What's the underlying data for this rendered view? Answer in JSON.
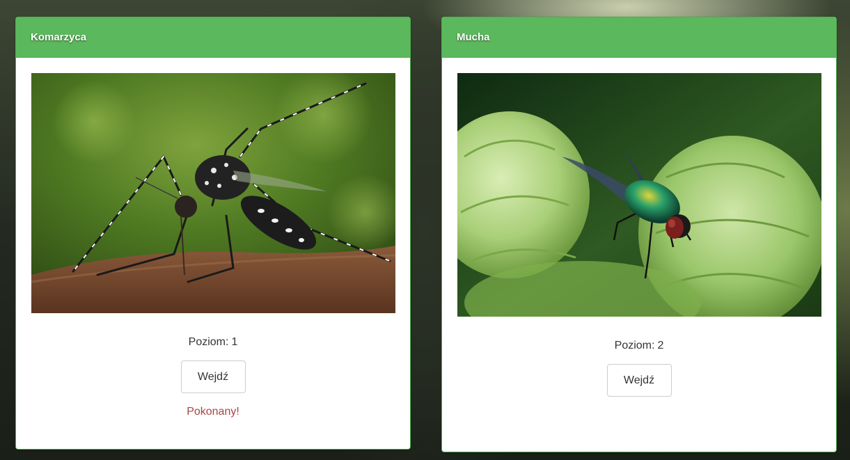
{
  "cards": [
    {
      "title": "Komarzyca",
      "level_label": "Poziom:",
      "level_value": "1",
      "button_label": "Wejdź",
      "status": "Pokonany!",
      "image_icon": "mosquito-photo"
    },
    {
      "title": "Mucha",
      "level_label": "Poziom:",
      "level_value": "2",
      "button_label": "Wejdź",
      "status": "",
      "image_icon": "fly-photo"
    }
  ],
  "colors": {
    "heading": "#5cb85c",
    "heading_border": "#4cae4c",
    "defeated": "#a94442",
    "text": "#333333"
  }
}
